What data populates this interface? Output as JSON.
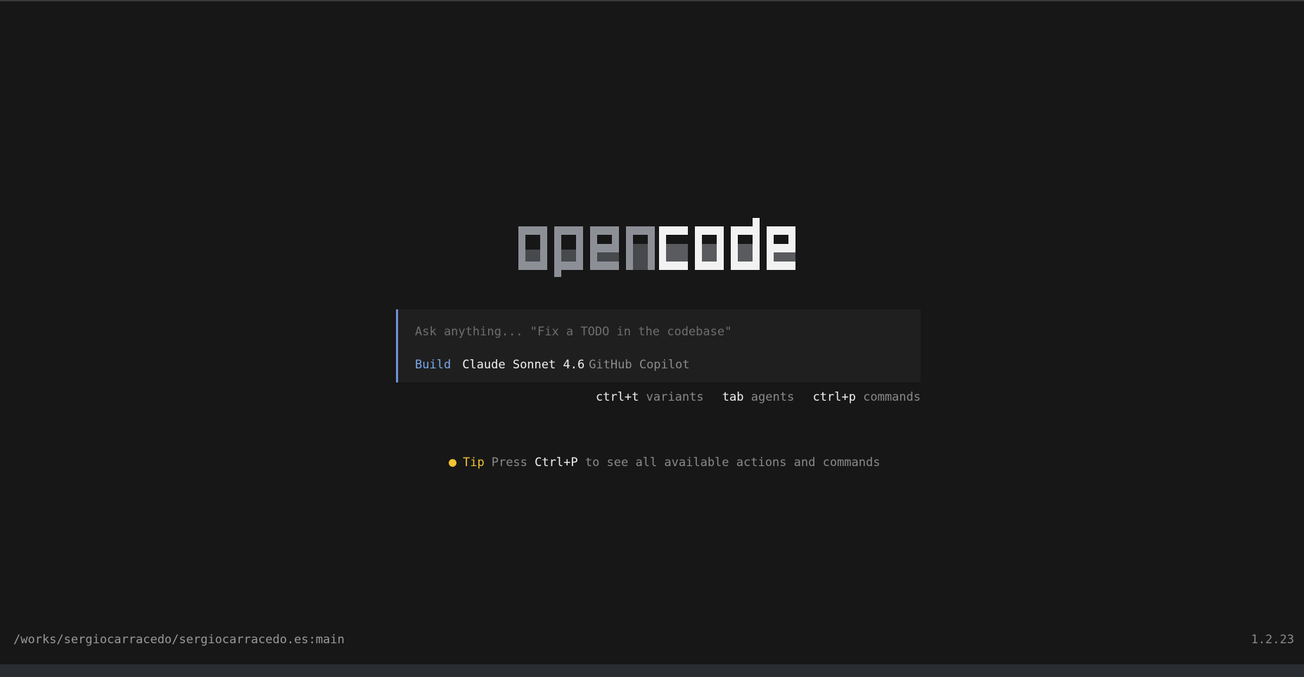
{
  "app": {
    "logo_text_light": "open",
    "logo_text_bold": "code"
  },
  "prompt": {
    "placeholder": "Ask anything... \"Fix a TODO in the codebase\"",
    "value": "",
    "agent_mode": "Build",
    "model": "Claude Sonnet 4.6",
    "provider": "GitHub Copilot",
    "accent_color": "#6f8fd8"
  },
  "shortcuts": [
    {
      "key": "ctrl+t",
      "label": "variants"
    },
    {
      "key": "tab",
      "label": "agents"
    },
    {
      "key": "ctrl+p",
      "label": "commands"
    }
  ],
  "tip": {
    "label": "Tip",
    "before": "Press",
    "key": "Ctrl+P",
    "after": "to see all available actions and commands",
    "color": "#f1c232"
  },
  "footer": {
    "cwd": "/works/sergiocarracedo/sergiocarracedo.es:main",
    "version": "1.2.23"
  }
}
